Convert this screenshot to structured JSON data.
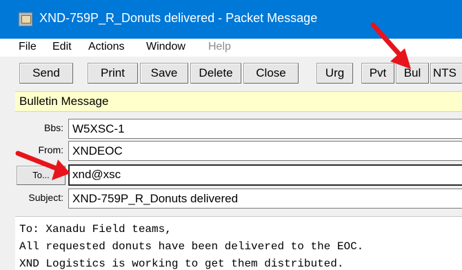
{
  "window": {
    "title": "XND-759P_R_Donuts delivered - Packet Message"
  },
  "menu": [
    {
      "label": "File",
      "enabled": true
    },
    {
      "label": "Edit",
      "enabled": true
    },
    {
      "label": "Actions",
      "enabled": true
    },
    {
      "label": "Window",
      "enabled": true
    },
    {
      "label": "Help",
      "enabled": false
    }
  ],
  "toolbar": {
    "send": "Send",
    "print": "Print",
    "save": "Save",
    "delete": "Delete",
    "close": "Close",
    "urg": "Urg",
    "pvt": "Pvt",
    "bul": "Bul",
    "nts": "NTS"
  },
  "banner": "Bulletin Message",
  "fields": {
    "bbs_label": "Bbs:",
    "bbs_value": "W5XSC-1",
    "from_label": "From:",
    "from_value": "XNDEOC",
    "to_button": "To...",
    "to_value": "xnd@xsc",
    "subject_label": "Subject:",
    "subject_value": "XND-759P_R_Donuts delivered"
  },
  "message": {
    "lines": [
      "To: Xanadu Field teams,",
      "All requested donuts have been delivered to the EOC.",
      "XND Logistics is working to get them distributed."
    ]
  },
  "colors": {
    "titlebar": "#0078d7",
    "banner": "#ffffcc",
    "annotation_arrow": "#e8141b"
  }
}
